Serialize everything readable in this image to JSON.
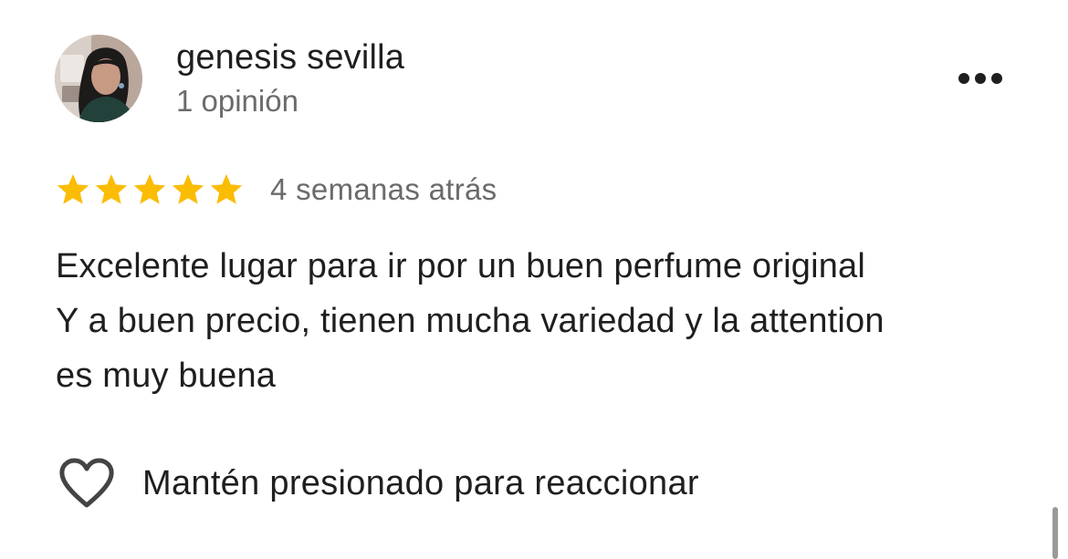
{
  "review": {
    "author": {
      "name": "genesis sevilla",
      "meta": "1 opinión",
      "avatar": "profile-photo"
    },
    "more_icon": "more-horizontal-icon",
    "rating": {
      "stars": 5,
      "max": 5,
      "color": "#FBBC04"
    },
    "time": "4 semanas atrás",
    "text_lines": [
      "Excelente lugar para ir por un buen perfume original",
      "Y a buen precio, tienen mucha variedad y la attention",
      "es muy buena"
    ],
    "reaction": {
      "icon": "heart-outline-icon",
      "label": "Mantén presionado para reaccionar"
    }
  }
}
